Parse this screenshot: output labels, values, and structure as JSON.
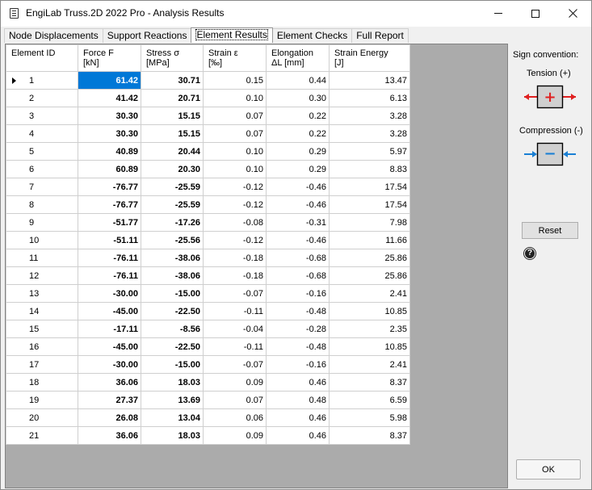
{
  "window": {
    "title": "EngiLab Truss.2D 2022 Pro - Analysis Results"
  },
  "tabs": [
    {
      "label": "Node Displacements"
    },
    {
      "label": "Support Reactions"
    },
    {
      "label": "Element Results"
    },
    {
      "label": "Element Checks"
    },
    {
      "label": "Full Report"
    }
  ],
  "active_tab": "Element Results",
  "grid": {
    "columns": [
      {
        "line1": "Element ID",
        "line2": ""
      },
      {
        "line1": "Force F",
        "line2": "[kN]"
      },
      {
        "line1": "Stress σ",
        "line2": "[MPa]"
      },
      {
        "line1": "Strain ε",
        "line2": "[‰]"
      },
      {
        "line1": "Elongation",
        "line2": "ΔL [mm]"
      },
      {
        "line1": "Strain Energy",
        "line2": "[J]"
      }
    ],
    "rows": [
      [
        "1",
        "61.42",
        "30.71",
        "0.15",
        "0.44",
        "13.47"
      ],
      [
        "2",
        "41.42",
        "20.71",
        "0.10",
        "0.30",
        "6.13"
      ],
      [
        "3",
        "30.30",
        "15.15",
        "0.07",
        "0.22",
        "3.28"
      ],
      [
        "4",
        "30.30",
        "15.15",
        "0.07",
        "0.22",
        "3.28"
      ],
      [
        "5",
        "40.89",
        "20.44",
        "0.10",
        "0.29",
        "5.97"
      ],
      [
        "6",
        "60.89",
        "20.30",
        "0.10",
        "0.29",
        "8.83"
      ],
      [
        "7",
        "-76.77",
        "-25.59",
        "-0.12",
        "-0.46",
        "17.54"
      ],
      [
        "8",
        "-76.77",
        "-25.59",
        "-0.12",
        "-0.46",
        "17.54"
      ],
      [
        "9",
        "-51.77",
        "-17.26",
        "-0.08",
        "-0.31",
        "7.98"
      ],
      [
        "10",
        "-51.11",
        "-25.56",
        "-0.12",
        "-0.46",
        "11.66"
      ],
      [
        "11",
        "-76.11",
        "-38.06",
        "-0.18",
        "-0.68",
        "25.86"
      ],
      [
        "12",
        "-76.11",
        "-38.06",
        "-0.18",
        "-0.68",
        "25.86"
      ],
      [
        "13",
        "-30.00",
        "-15.00",
        "-0.07",
        "-0.16",
        "2.41"
      ],
      [
        "14",
        "-45.00",
        "-22.50",
        "-0.11",
        "-0.48",
        "10.85"
      ],
      [
        "15",
        "-17.11",
        "-8.56",
        "-0.04",
        "-0.28",
        "2.35"
      ],
      [
        "16",
        "-45.00",
        "-22.50",
        "-0.11",
        "-0.48",
        "10.85"
      ],
      [
        "17",
        "-30.00",
        "-15.00",
        "-0.07",
        "-0.16",
        "2.41"
      ],
      [
        "18",
        "36.06",
        "18.03",
        "0.09",
        "0.46",
        "8.37"
      ],
      [
        "19",
        "27.37",
        "13.69",
        "0.07",
        "0.48",
        "6.59"
      ],
      [
        "20",
        "26.08",
        "13.04",
        "0.06",
        "0.46",
        "5.98"
      ],
      [
        "21",
        "36.06",
        "18.03",
        "0.09",
        "0.46",
        "8.37"
      ]
    ],
    "selected_row": 0,
    "selected_col": 1
  },
  "side_panel": {
    "sign_convention_label": "Sign convention:",
    "tension_label": "Tension (+)",
    "tension_symbol": "+",
    "compression_label": "Compression (-)",
    "compression_symbol": "−",
    "tension_color": "#e02020",
    "compression_color": "#1a7fd4",
    "reset_label": "Reset",
    "help_symbol": "?",
    "ok_label": "OK"
  },
  "colors": {
    "selection": "#0078d7",
    "grid_background": "#ababab"
  }
}
